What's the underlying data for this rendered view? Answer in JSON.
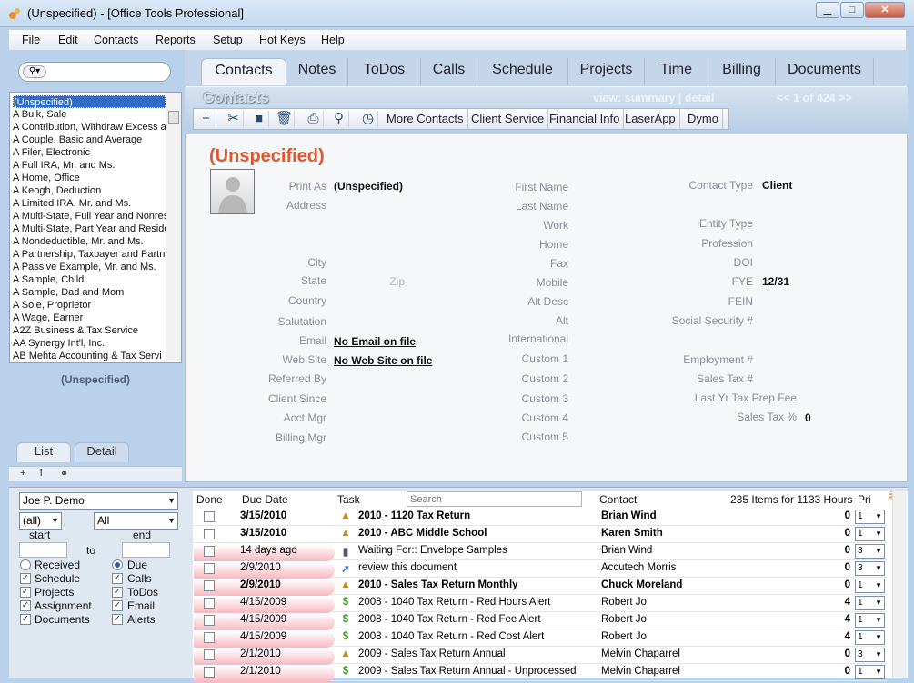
{
  "window": {
    "title": "(Unspecified) - [Office Tools Professional]",
    "minimize": "▁",
    "maximize": "□",
    "close": "✕"
  },
  "menu": [
    "File",
    "Edit",
    "Contacts",
    "Reports",
    "Setup",
    "Hot Keys",
    "Help"
  ],
  "contact_list": [
    "(Unspecified)",
    "A Bulk, Sale",
    "A Contribution, Withdraw Excess and",
    "A Couple, Basic and Average",
    "A Filer, Electronic",
    "A Full IRA, Mr. and Ms.",
    "A Home, Office",
    "A Keogh, Deduction",
    "A Limited IRA, Mr. and Ms.",
    "A Multi-State, Full Year and Nonres",
    "A Multi-State, Part Year and Reside",
    "A Nondeductible, Mr. and Ms.",
    "A Partnership, Taxpayer and Partne",
    "A Passive Example, Mr. and Ms.",
    "A Sample, Child",
    "A Sample, Dad and Mom",
    "A Sole, Proprietor",
    "A Wage, Earner",
    "A2Z Business & Tax Service",
    "AA Synergy Int'l, Inc.",
    "AB Mehta  Accounting & Tax Servi"
  ],
  "selected_contact": "(Unspecified)",
  "left_tabs": [
    "List",
    "Detail"
  ],
  "main_tabs": [
    "Contacts",
    "Notes",
    "ToDos",
    "Calls",
    "Schedule",
    "Projects",
    "Time",
    "Billing",
    "Documents"
  ],
  "section_title": "Contacts",
  "view": {
    "prefix": "view:",
    "summary": "summary",
    "sep": "|",
    "detail": "detail"
  },
  "pager": {
    "prev": "<<",
    "current": "1",
    "of": "of",
    "total": "424",
    "next": ">>"
  },
  "toolbar_buttons": [
    "More Contacts",
    "Client Service",
    "Financial Info",
    "LaserApp",
    "Dymo"
  ],
  "toolbar_icons": {
    "add": "+",
    "tools": "✂",
    "save": "■",
    "delete": "🗑",
    "print": "⎙",
    "find": "⚲",
    "clock": "◷"
  },
  "record": {
    "name": "(Unspecified)",
    "col1_labels": {
      "print_as": "Print As",
      "address": "Address",
      "city": "City",
      "state": "State",
      "zip": "Zip",
      "country": "Country",
      "salutation": "Salutation",
      "email": "Email",
      "website": "Web Site",
      "referred_by": "Referred By",
      "client_since": "Client Since",
      "acct_mgr": "Acct Mgr",
      "billing_mgr": "Billing Mgr"
    },
    "col1_values": {
      "print_as": "(Unspecified)",
      "email": "No Email on file",
      "website": "No Web Site on file"
    },
    "col2_labels": {
      "first_name": "First Name",
      "last_name": "Last Name",
      "work": "Work",
      "home": "Home",
      "fax": "Fax",
      "mobile": "Mobile",
      "alt_desc": "Alt Desc",
      "alt": "Alt",
      "international": "International",
      "custom1": "Custom 1",
      "custom2": "Custom 2",
      "custom3": "Custom 3",
      "custom4": "Custom 4",
      "custom5": "Custom 5"
    },
    "col3_labels": {
      "contact_type": "Contact Type",
      "entity_type": "Entity Type",
      "profession": "Profession",
      "doi": "DOI",
      "fye": "FYE",
      "fein": "FEIN",
      "ssn": "Social Security #",
      "employment": "Employment #",
      "sales_tax_num": "Sales Tax #",
      "last_yr_fee": "Last Yr Tax Prep Fee",
      "sales_tax_pct": "Sales Tax %"
    },
    "col3_values": {
      "contact_type": "Client",
      "fye": "12/31",
      "sales_tax_pct": "0"
    }
  },
  "filters": {
    "user": "Joe P. Demo",
    "scope": "(all)",
    "status": "All",
    "start_label": "start",
    "end_label": "end",
    "to_label": "to",
    "received": "Received",
    "due": "Due",
    "left_checks": [
      "Schedule",
      "Projects",
      "Assignment",
      "Documents"
    ],
    "right_checks": [
      "Calls",
      "ToDos",
      "Email",
      "Alerts"
    ]
  },
  "grid": {
    "headers": {
      "done": "Done",
      "due_date": "Due Date",
      "task": "Task",
      "contact": "Contact",
      "pri": "Pri"
    },
    "search_placeholder": "Search",
    "summary": "235 Items for 1133 Hours",
    "rows": [
      {
        "due": "3/15/2010",
        "task": "2010 - 1120 Tax Return",
        "contact": "Brian Wind",
        "hours": "0",
        "pri": "1",
        "bold": true,
        "pink": false,
        "icon": "▲",
        "icon_color": "#c98a1a"
      },
      {
        "due": "3/15/2010",
        "task": "2010 - ABC Middle School",
        "contact": "Karen Smith",
        "hours": "0",
        "pri": "1",
        "bold": true,
        "pink": false,
        "icon": "▲",
        "icon_color": "#c98a1a"
      },
      {
        "due": "14 days ago",
        "task": "Waiting For:: Envelope Samples",
        "contact": "Brian Wind",
        "hours": "0",
        "pri": "3",
        "bold": false,
        "pink": true,
        "icon": "▮",
        "icon_color": "#556"
      },
      {
        "due": "2/9/2010",
        "task": "review this document",
        "contact": "Accutech Morris",
        "hours": "0",
        "pri": "3",
        "bold": false,
        "pink": true,
        "icon": "➚",
        "icon_color": "#3a78c6"
      },
      {
        "due": "2/9/2010",
        "task": "2010 - Sales Tax Return Monthly",
        "contact": "Chuck Moreland",
        "hours": "0",
        "pri": "1",
        "bold": true,
        "pink": true,
        "icon": "▲",
        "icon_color": "#c98a1a"
      },
      {
        "due": "4/15/2009",
        "task": "2008 - 1040 Tax Return - Red Hours Alert",
        "contact": "Robert Jo",
        "hours": "4",
        "pri": "1",
        "bold": false,
        "pink": true,
        "icon": "$",
        "icon_color": "#3d9a2a"
      },
      {
        "due": "4/15/2009",
        "task": "2008 - 1040 Tax Return - Red Fee Alert",
        "contact": "Robert Jo",
        "hours": "4",
        "pri": "1",
        "bold": false,
        "pink": true,
        "icon": "$",
        "icon_color": "#3d9a2a"
      },
      {
        "due": "4/15/2009",
        "task": "2008 - 1040 Tax Return - Red Cost Alert",
        "contact": "Robert Jo",
        "hours": "4",
        "pri": "1",
        "bold": false,
        "pink": true,
        "icon": "$",
        "icon_color": "#3d9a2a"
      },
      {
        "due": "2/1/2010",
        "task": "2009 - Sales Tax Return Annual",
        "contact": "Melvin Chaparrel",
        "hours": "0",
        "pri": "3",
        "bold": false,
        "pink": true,
        "icon": "▲",
        "icon_color": "#c98a1a"
      },
      {
        "due": "2/1/2010",
        "task": "2009 - Sales Tax Return Annual - Unprocessed",
        "contact": "Melvin Chaparrel",
        "hours": "0",
        "pri": "1",
        "bold": false,
        "pink": true,
        "icon": "$",
        "icon_color": "#3d9a2a"
      }
    ]
  },
  "left_toolbar": {
    "add": "+",
    "info": "i",
    "link": "⚭"
  }
}
